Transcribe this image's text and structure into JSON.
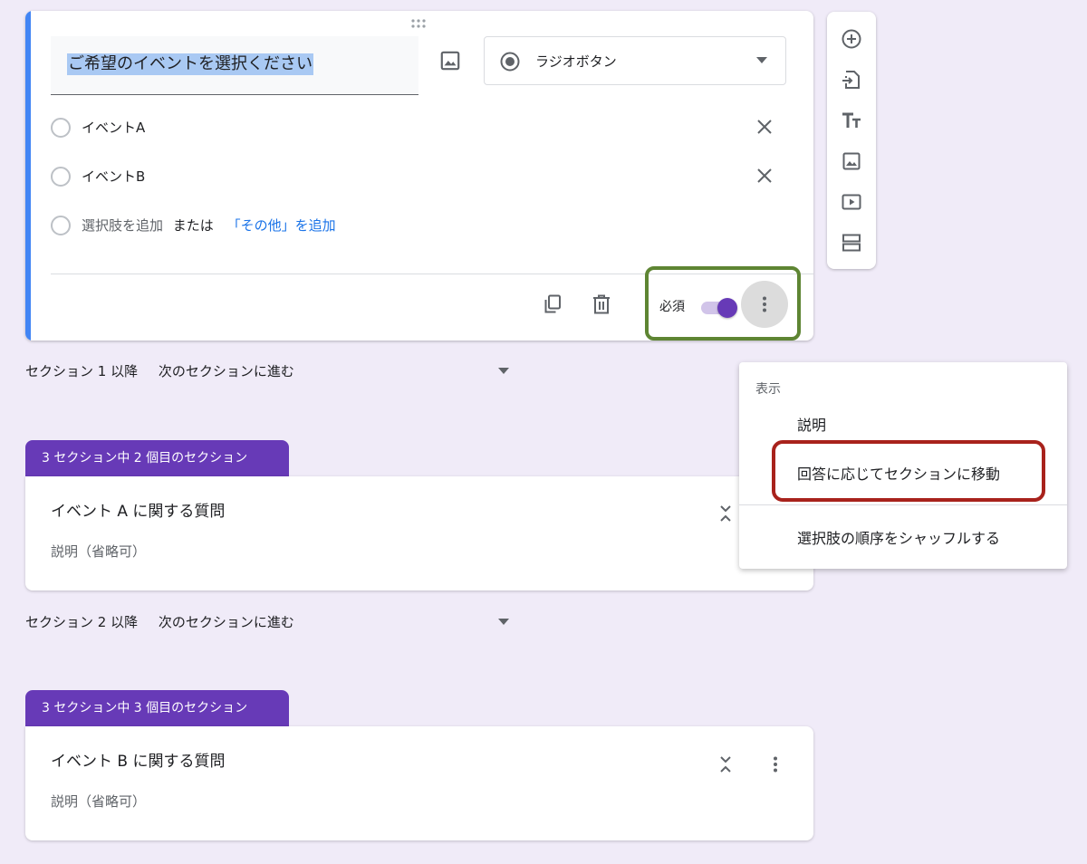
{
  "question": {
    "title": "ご希望のイベントを選択ください",
    "type_label": "ラジオボタン",
    "options": [
      "イベントA",
      "イベントB"
    ],
    "add_option": "選択肢を追加",
    "or_text": "または",
    "add_other": "「その他」を追加",
    "required_label": "必須",
    "required": true
  },
  "section_nav": [
    {
      "label": "セクション 1 以降",
      "value": "次のセクションに進む"
    },
    {
      "label": "セクション 2 以降",
      "value": "次のセクションに進む"
    }
  ],
  "sections": [
    {
      "tab": "3 セクション中 2 個目のセクション",
      "title": "イベント A に関する質問",
      "description": "説明（省略可）"
    },
    {
      "tab": "3 セクション中 3 個目のセクション",
      "title": "イベント B に関する質問",
      "description": "説明（省略可）"
    }
  ],
  "menu": {
    "header": "表示",
    "items": [
      "説明",
      "回答に応じてセクションに移動",
      "選択肢の順序をシャッフルする"
    ]
  },
  "toolbar": {
    "icons": [
      "add-question-icon",
      "import-questions-icon",
      "add-title-icon",
      "add-image-icon",
      "add-video-icon",
      "add-section-icon"
    ]
  },
  "colors": {
    "background": "#f0ebf8",
    "accent_purple": "#673ab7",
    "focus_blue": "#4285f4",
    "highlight_green": "#5e8533",
    "highlight_red": "#a8221c",
    "link_blue": "#1a73e8"
  }
}
